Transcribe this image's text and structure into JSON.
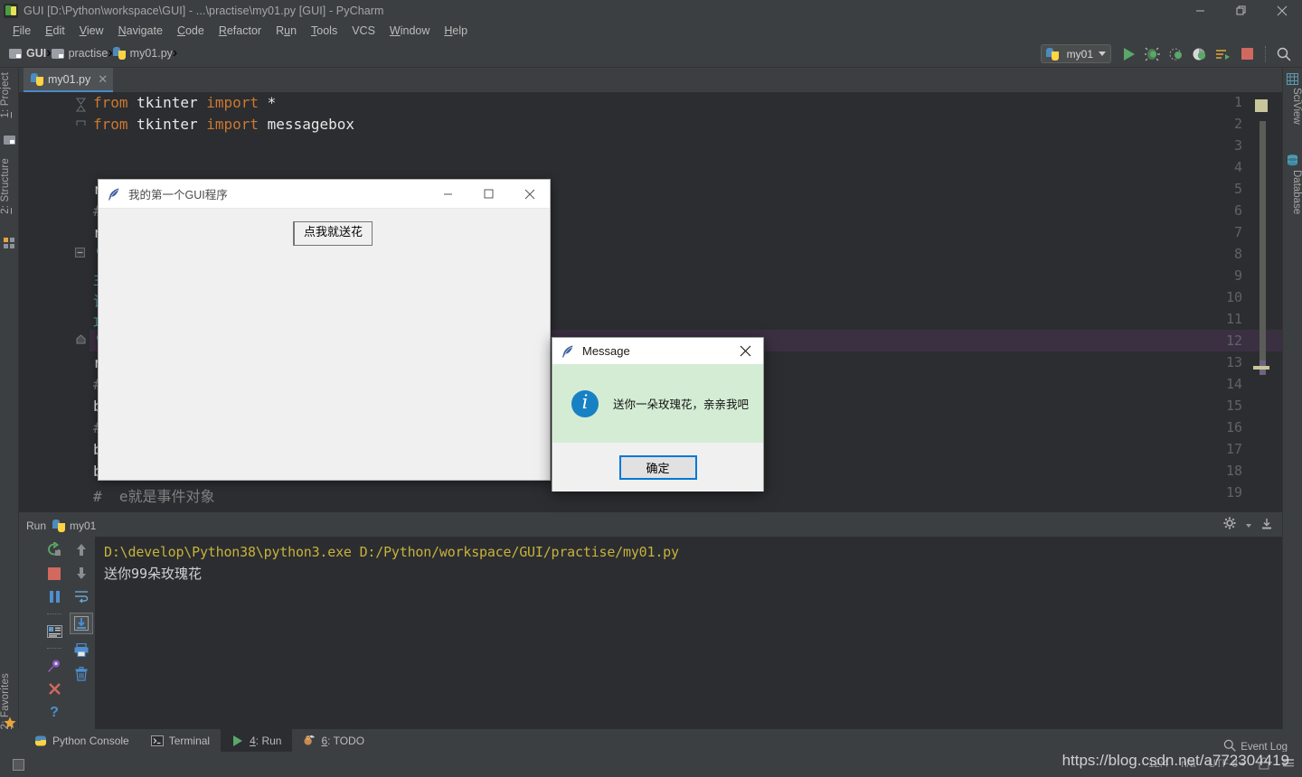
{
  "window": {
    "title": "GUI [D:\\Python\\workspace\\GUI] - ...\\practise\\my01.py [GUI] - PyCharm",
    "minimize": "—",
    "maximize": "❐",
    "close": "✕"
  },
  "menubar": {
    "items": [
      {
        "mnemonic": "F",
        "rest": "ile"
      },
      {
        "mnemonic": "E",
        "rest": "dit"
      },
      {
        "mnemonic": "V",
        "rest": "iew"
      },
      {
        "mnemonic": "N",
        "rest": "avigate"
      },
      {
        "mnemonic": "C",
        "rest": "ode"
      },
      {
        "mnemonic": "R",
        "rest": "efactor"
      },
      {
        "mnemonic": "R",
        "rest": "un",
        "pre": "R",
        "mn_index": 1
      },
      {
        "mnemonic": "T",
        "rest": "ools"
      },
      {
        "mnemonic": "",
        "rest": "VCS"
      },
      {
        "mnemonic": "W",
        "rest": "indow"
      },
      {
        "mnemonic": "H",
        "rest": "elp"
      }
    ],
    "labels": [
      "File",
      "Edit",
      "View",
      "Navigate",
      "Code",
      "Refactor",
      "Run",
      "Tools",
      "VCS",
      "Window",
      "Help"
    ]
  },
  "breadcrumb": {
    "items": [
      "GUI",
      "practise",
      "my01.py"
    ],
    "separator": "›"
  },
  "toolbar": {
    "run_config": "my01",
    "buttons": [
      "run-button",
      "debug-button",
      "coverage-button",
      "profile-button",
      "run-with-console-button",
      "stop-button",
      "search-everywhere-button"
    ]
  },
  "left_stripe": {
    "tabs": [
      {
        "num": "1",
        "label": ": Project",
        "icon": "project-icon"
      },
      {
        "num": "2",
        "label": ": Structure",
        "icon": "structure-icon"
      },
      {
        "num": "2",
        "label": ": Favorites",
        "icon": "favorites-star-icon"
      }
    ]
  },
  "right_stripe": {
    "tabs": [
      {
        "label": "SciView",
        "icon": "sciview-icon"
      },
      {
        "label": "Database",
        "icon": "database-icon"
      }
    ]
  },
  "editor": {
    "tab": {
      "label": "my01.py",
      "close": "✕"
    },
    "lines": [
      {
        "n": 1,
        "tokens": [
          {
            "t": "from",
            "c": "kw"
          },
          {
            "t": " tkinter ",
            "c": "pl"
          },
          {
            "t": "import",
            "c": "kw"
          },
          {
            "t": " *",
            "c": "pl"
          }
        ]
      },
      {
        "n": 2,
        "tokens": [
          {
            "t": "from",
            "c": "kw"
          },
          {
            "t": " tkinter ",
            "c": "pl"
          },
          {
            "t": "import",
            "c": "kw"
          },
          {
            "t": " messagebox",
            "c": "pl"
          }
        ]
      },
      {
        "n": 3,
        "tokens": []
      },
      {
        "n": 4,
        "tokens": []
      },
      {
        "n": 5,
        "tokens": [
          {
            "t": "r",
            "c": "pl"
          }
        ]
      },
      {
        "n": 6,
        "tokens": [
          {
            "t": "#",
            "c": "cmt"
          }
        ]
      },
      {
        "n": 7,
        "tokens": [
          {
            "t": "r",
            "c": "pl"
          }
        ]
      },
      {
        "n": 8,
        "tokens": [
          {
            "t": "\"",
            "c": "teal"
          }
        ]
      },
      {
        "n": 9,
        "tokens": [
          {
            "t": "主",
            "c": "teal"
          }
        ]
      },
      {
        "n": 10,
        "tokens": [
          {
            "t": "该",
            "c": "teal"
          }
        ]
      },
      {
        "n": 11,
        "tokens": [
          {
            "t": "功",
            "c": "teal"
          }
        ]
      },
      {
        "n": 12,
        "tokens": [
          {
            "t": "\"",
            "c": "teal"
          }
        ]
      },
      {
        "n": 13,
        "tokens": [
          {
            "t": "r",
            "c": "pl"
          }
        ]
      },
      {
        "n": 14,
        "tokens": [
          {
            "t": "#",
            "c": "cmt"
          }
        ]
      },
      {
        "n": 15,
        "tokens": [
          {
            "t": "b",
            "c": "pl"
          }
        ]
      },
      {
        "n": 16,
        "tokens": [
          {
            "t": "#",
            "c": "cmt"
          }
        ]
      },
      {
        "n": 17,
        "tokens": [
          {
            "t": "b",
            "c": "pl"
          }
        ]
      },
      {
        "n": 18,
        "tokens": [
          {
            "t": "b",
            "c": "pl"
          }
        ]
      },
      {
        "n": 19,
        "tokens": [
          {
            "t": "#  e就是事件对象",
            "c": "cmt"
          }
        ]
      }
    ],
    "caret_line": 12
  },
  "tk_window": {
    "title": "我的第一个GUI程序",
    "icon": "tkinter-feather-icon",
    "button_label": "点我就送花",
    "minimize": "—",
    "maximize": "□",
    "close": "✕"
  },
  "message_dialog": {
    "title": "Message",
    "icon": "tkinter-feather-icon",
    "close": "✕",
    "info_glyph": "i",
    "text": "送你一朵玫瑰花，亲亲我吧",
    "ok_label": "确定",
    "content_bg": "#d4ecd4",
    "accent": "#0078d7",
    "info_color": "#1881c4"
  },
  "run_panel": {
    "header_label": "Run",
    "config_name": "my01",
    "left_icons": [
      "rerun-icon",
      "stop-icon",
      "pause-icon",
      "console-icon",
      "pin-icon",
      "close-icon",
      "help-icon"
    ],
    "right_icons": [
      "wrap-text-icon",
      "scroll-to-end-icon",
      "print-icon",
      "trash-icon"
    ],
    "header_right_icons": [
      "settings-gear-icon",
      "hide-icon"
    ],
    "console": {
      "command": "D:\\develop\\Python38\\python3.exe D:/Python/workspace/GUI/practise/my01.py",
      "output": "送你99朵玫瑰花"
    }
  },
  "bottom_tabs": [
    {
      "label": "Python Console",
      "mnemonic": "",
      "icon": "python-console-icon",
      "active": false
    },
    {
      "label": "Terminal",
      "mnemonic": "",
      "icon": "terminal-icon",
      "active": false
    },
    {
      "num": "4",
      "label": ": Run",
      "icon": "run-play-icon",
      "active": true
    },
    {
      "num": "6",
      "label": ": TODO",
      "icon": "todo-icon",
      "active": false
    }
  ],
  "status_bar": {
    "event_log": "Event Log",
    "position": "12:4",
    "line_sep": "n/a",
    "encoding": "UTF-8",
    "icons": [
      "search-icon",
      "lock-icon",
      "hide-icon"
    ]
  },
  "watermark": "https://blog.csdn.net/a772304419",
  "colors": {
    "ide_chrome": "#3c3f41",
    "editor_bg": "#2b2d30",
    "accent_blue": "#4a88c7",
    "console_yellow": "#c8b23c",
    "run_green": "#59a869"
  }
}
